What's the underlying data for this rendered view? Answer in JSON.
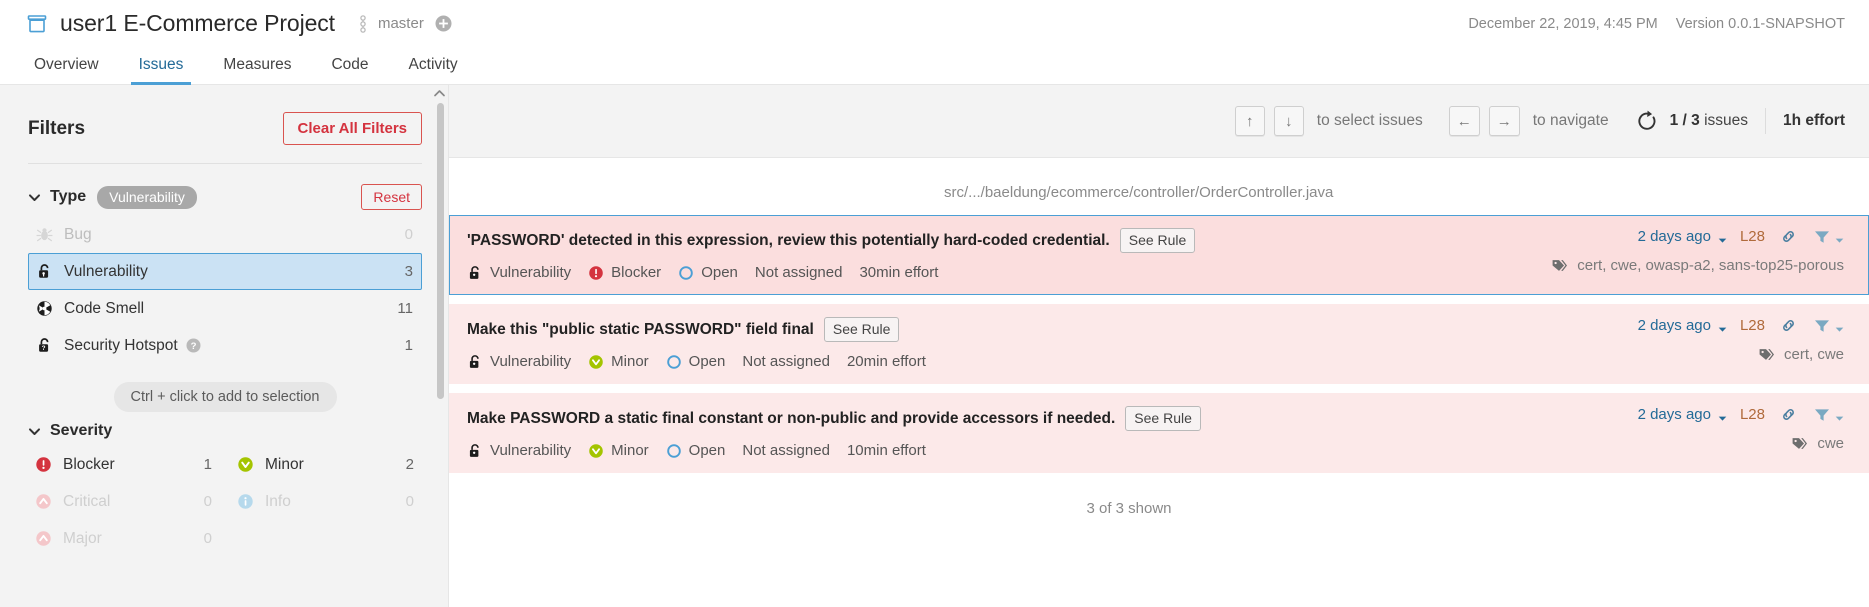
{
  "header": {
    "project_icon": "project-icon",
    "project_title": "user1 E-Commerce Project",
    "branch_icon": "branch-icon",
    "branch_name": "master",
    "branch_add_icon": "plus-circle-icon",
    "analysis_date": "December 22, 2019, 4:45 PM",
    "version": "Version 0.0.1-SNAPSHOT"
  },
  "nav": {
    "tabs": [
      {
        "label": "Overview",
        "active": false
      },
      {
        "label": "Issues",
        "active": true
      },
      {
        "label": "Measures",
        "active": false
      },
      {
        "label": "Code",
        "active": false
      },
      {
        "label": "Activity",
        "active": false
      }
    ]
  },
  "sidebar": {
    "title": "Filters",
    "clear_all_label": "Clear All Filters",
    "type_facet": {
      "name": "Type",
      "chip": "Vulnerability",
      "reset_label": "Reset",
      "items": [
        {
          "label": "Bug",
          "count": "0",
          "icon": "bug-icon",
          "state": "dim"
        },
        {
          "label": "Vulnerability",
          "count": "3",
          "icon": "vulnerability-icon",
          "state": "selected"
        },
        {
          "label": "Code Smell",
          "count": "11",
          "icon": "code-smell-icon",
          "state": "normal"
        },
        {
          "label": "Security Hotspot",
          "count": "1",
          "icon": "security-hotspot-icon",
          "state": "normal",
          "help": "help-icon"
        }
      ]
    },
    "ctrl_hint": "Ctrl + click to add to selection",
    "severity_facet": {
      "name": "Severity",
      "items": [
        {
          "label": "Blocker",
          "count": "1",
          "icon": "blocker-icon",
          "state": "normal"
        },
        {
          "label": "Minor",
          "count": "2",
          "icon": "minor-icon",
          "state": "normal"
        },
        {
          "label": "Critical",
          "count": "0",
          "icon": "critical-icon",
          "state": "dim"
        },
        {
          "label": "Info",
          "count": "0",
          "icon": "info-icon",
          "state": "dim"
        },
        {
          "label": "Major",
          "count": "0",
          "icon": "major-icon",
          "state": "dim"
        }
      ]
    }
  },
  "toolbar": {
    "key_up": "↑",
    "key_down": "↓",
    "select_hint": "to select issues",
    "key_left": "←",
    "key_right": "→",
    "navigate_hint": "to navigate",
    "reload_icon": "reload-icon",
    "issue_position": "1 / 3",
    "issue_count_suffix": "issues",
    "total_effort": "1h effort"
  },
  "issues_list": {
    "file_path": "src/.../baeldung/ecommerce/controller/OrderController.java",
    "see_rule_label": "See Rule",
    "shown_footer": "3 of 3 shown",
    "issues": [
      {
        "title": "'PASSWORD' detected in this expression, review this potentially hard-coded credential.",
        "type": "Vulnerability",
        "type_icon": "vulnerability-icon",
        "severity": "Blocker",
        "severity_icon": "blocker-icon",
        "status": "Open",
        "status_icon": "open-status-icon",
        "assignee": "Not assigned",
        "effort": "30min effort",
        "date": "2 days ago",
        "line": "L28",
        "tags": "cert, cwe, owasp-a2, sans-top25-porous",
        "selected": true
      },
      {
        "title": "Make this \"public static PASSWORD\" field final",
        "type": "Vulnerability",
        "type_icon": "vulnerability-icon",
        "severity": "Minor",
        "severity_icon": "minor-icon",
        "status": "Open",
        "status_icon": "open-status-icon",
        "assignee": "Not assigned",
        "effort": "20min effort",
        "date": "2 days ago",
        "line": "L28",
        "tags": "cert, cwe",
        "selected": false
      },
      {
        "title": "Make PASSWORD a static final constant or non-public and provide accessors if needed.",
        "type": "Vulnerability",
        "type_icon": "vulnerability-icon",
        "severity": "Minor",
        "severity_icon": "minor-icon",
        "status": "Open",
        "status_icon": "open-status-icon",
        "assignee": "Not assigned",
        "effort": "10min effort",
        "date": "2 days ago",
        "line": "L28",
        "tags": "cwe",
        "selected": false
      }
    ]
  },
  "colors": {
    "accent_blue": "#4b9fd5",
    "link_blue": "#236a97",
    "danger_red": "#d4333f",
    "issue_bg": "#fce9e9",
    "blocker_red": "#d4333f",
    "minor_green": "#a4c400",
    "line_orange": "#b06a3b",
    "sidebar_bg": "#f3f3f3"
  }
}
